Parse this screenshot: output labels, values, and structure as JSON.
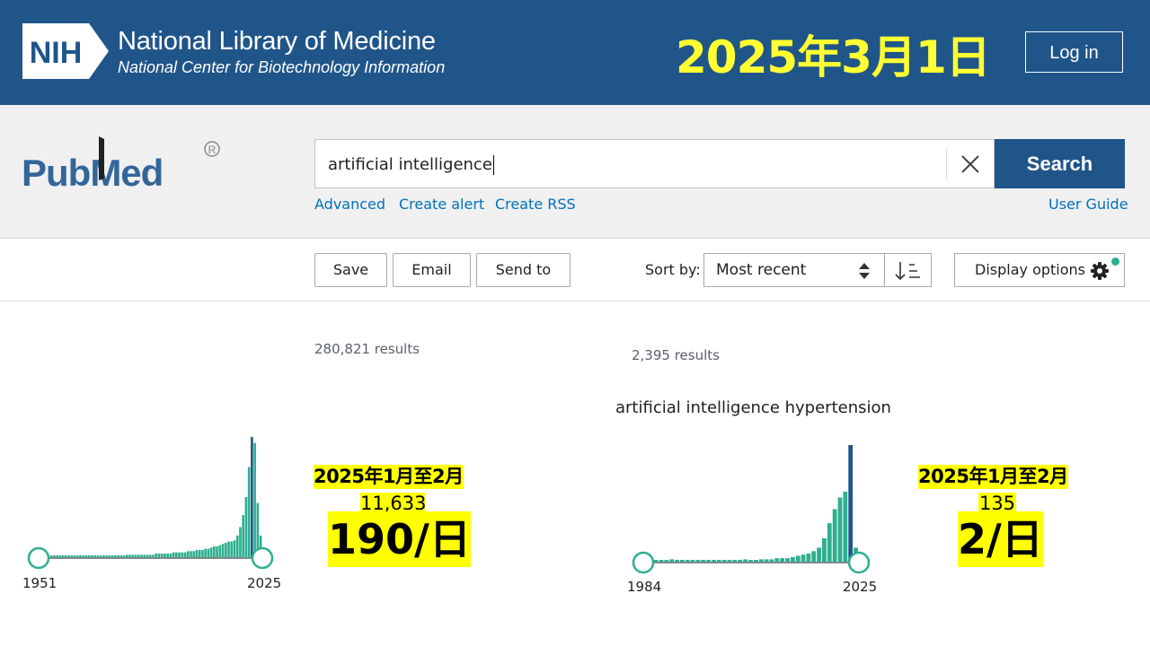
{
  "header": {
    "logo_text": "NIH",
    "title": "National Library of Medicine",
    "subtitle": "National Center for Biotechnology Information",
    "date_overlay": "2025年3月1日",
    "login_label": "Log in"
  },
  "search": {
    "logo_text": "PubMed",
    "query": "artificial intelligence",
    "button_label": "Search",
    "links": [
      "Advanced",
      "Create alert",
      "Create RSS"
    ],
    "user_guide": "User Guide"
  },
  "toolbar": {
    "save_label": "Save",
    "email_label": "Email",
    "send_to_label": "Send to",
    "sort_label": "Sort by:",
    "sort_value": "Most recent",
    "display_label": "Display options"
  },
  "results": [
    {
      "count_text": "280,821 results",
      "query_label": "",
      "year_start": "1951",
      "year_end": "2025",
      "chart_data": {
        "type": "bar",
        "x_range": [
          1951,
          2025
        ],
        "values": [
          1,
          1,
          1,
          1,
          1,
          1,
          1,
          1,
          1,
          1,
          1,
          1,
          1,
          1,
          1,
          1,
          1,
          1,
          1,
          1,
          1,
          1,
          1,
          1,
          1,
          1,
          1,
          1,
          1,
          1,
          2,
          2,
          2,
          2,
          2,
          2,
          2,
          2,
          2,
          2,
          3,
          3,
          3,
          3,
          3,
          3,
          4,
          4,
          4,
          4,
          4,
          5,
          5,
          5,
          6,
          6,
          6,
          7,
          7,
          8,
          9,
          9,
          10,
          11,
          12,
          13,
          13,
          14,
          18,
          25,
          35,
          50,
          75,
          100,
          95,
          45,
          18
        ]
      },
      "annotation": {
        "period": "2025年1月至2月",
        "count": "11,633",
        "rate": "190/日"
      }
    },
    {
      "count_text": "2,395 results",
      "query_label": "artificial intelligence hypertension",
      "year_start": "1984",
      "year_end": "2025",
      "chart_data": {
        "type": "bar",
        "x_range": [
          1984,
          2025
        ],
        "values": [
          1,
          1,
          1,
          1,
          1,
          2,
          1,
          1,
          1,
          1,
          1,
          1,
          1,
          1,
          1,
          1,
          1,
          1,
          1,
          2,
          1,
          1,
          2,
          2,
          2,
          3,
          3,
          3,
          4,
          5,
          6,
          7,
          9,
          12,
          20,
          33,
          45,
          55,
          60,
          100,
          12
        ]
      },
      "annotation": {
        "period": "2025年1月至2月",
        "count": "135",
        "rate": "2/日"
      }
    }
  ],
  "colors": {
    "header_bg": "#20558a",
    "accent_teal": "#2eaf8f",
    "bar_dark": "#20558a",
    "highlight": "#ffff00",
    "date_text": "#ffff33"
  }
}
